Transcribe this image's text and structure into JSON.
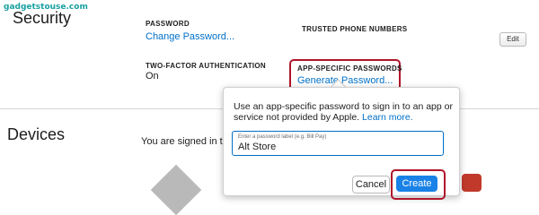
{
  "watermark": "gadgetstouse.com",
  "security": {
    "title": "Security",
    "password_label": "PASSWORD",
    "change_password_link": "Change Password...",
    "trusted_numbers_label": "TRUSTED PHONE NUMBERS",
    "edit_button": "Edit",
    "two_factor_label": "TWO-FACTOR AUTHENTICATION",
    "two_factor_value": "On",
    "app_specific_label": "APP-SPECIFIC PASSWORDS",
    "generate_password_link": "Generate Password..."
  },
  "devices": {
    "title": "Devices",
    "signed_in_text": "You are signed in to"
  },
  "popover": {
    "description": "Use an app-specific password to sign in to an app or service not provided by Apple.",
    "learn_more": "Learn more.",
    "input_label": "Enter a password label (e.g. Bill Pay)",
    "input_value": "Alt Store",
    "cancel_button": "Cancel",
    "create_button": "Create"
  },
  "colors": {
    "link": "#0070c9",
    "highlight": "#b0152a",
    "primary_button": "#1a82e6"
  }
}
